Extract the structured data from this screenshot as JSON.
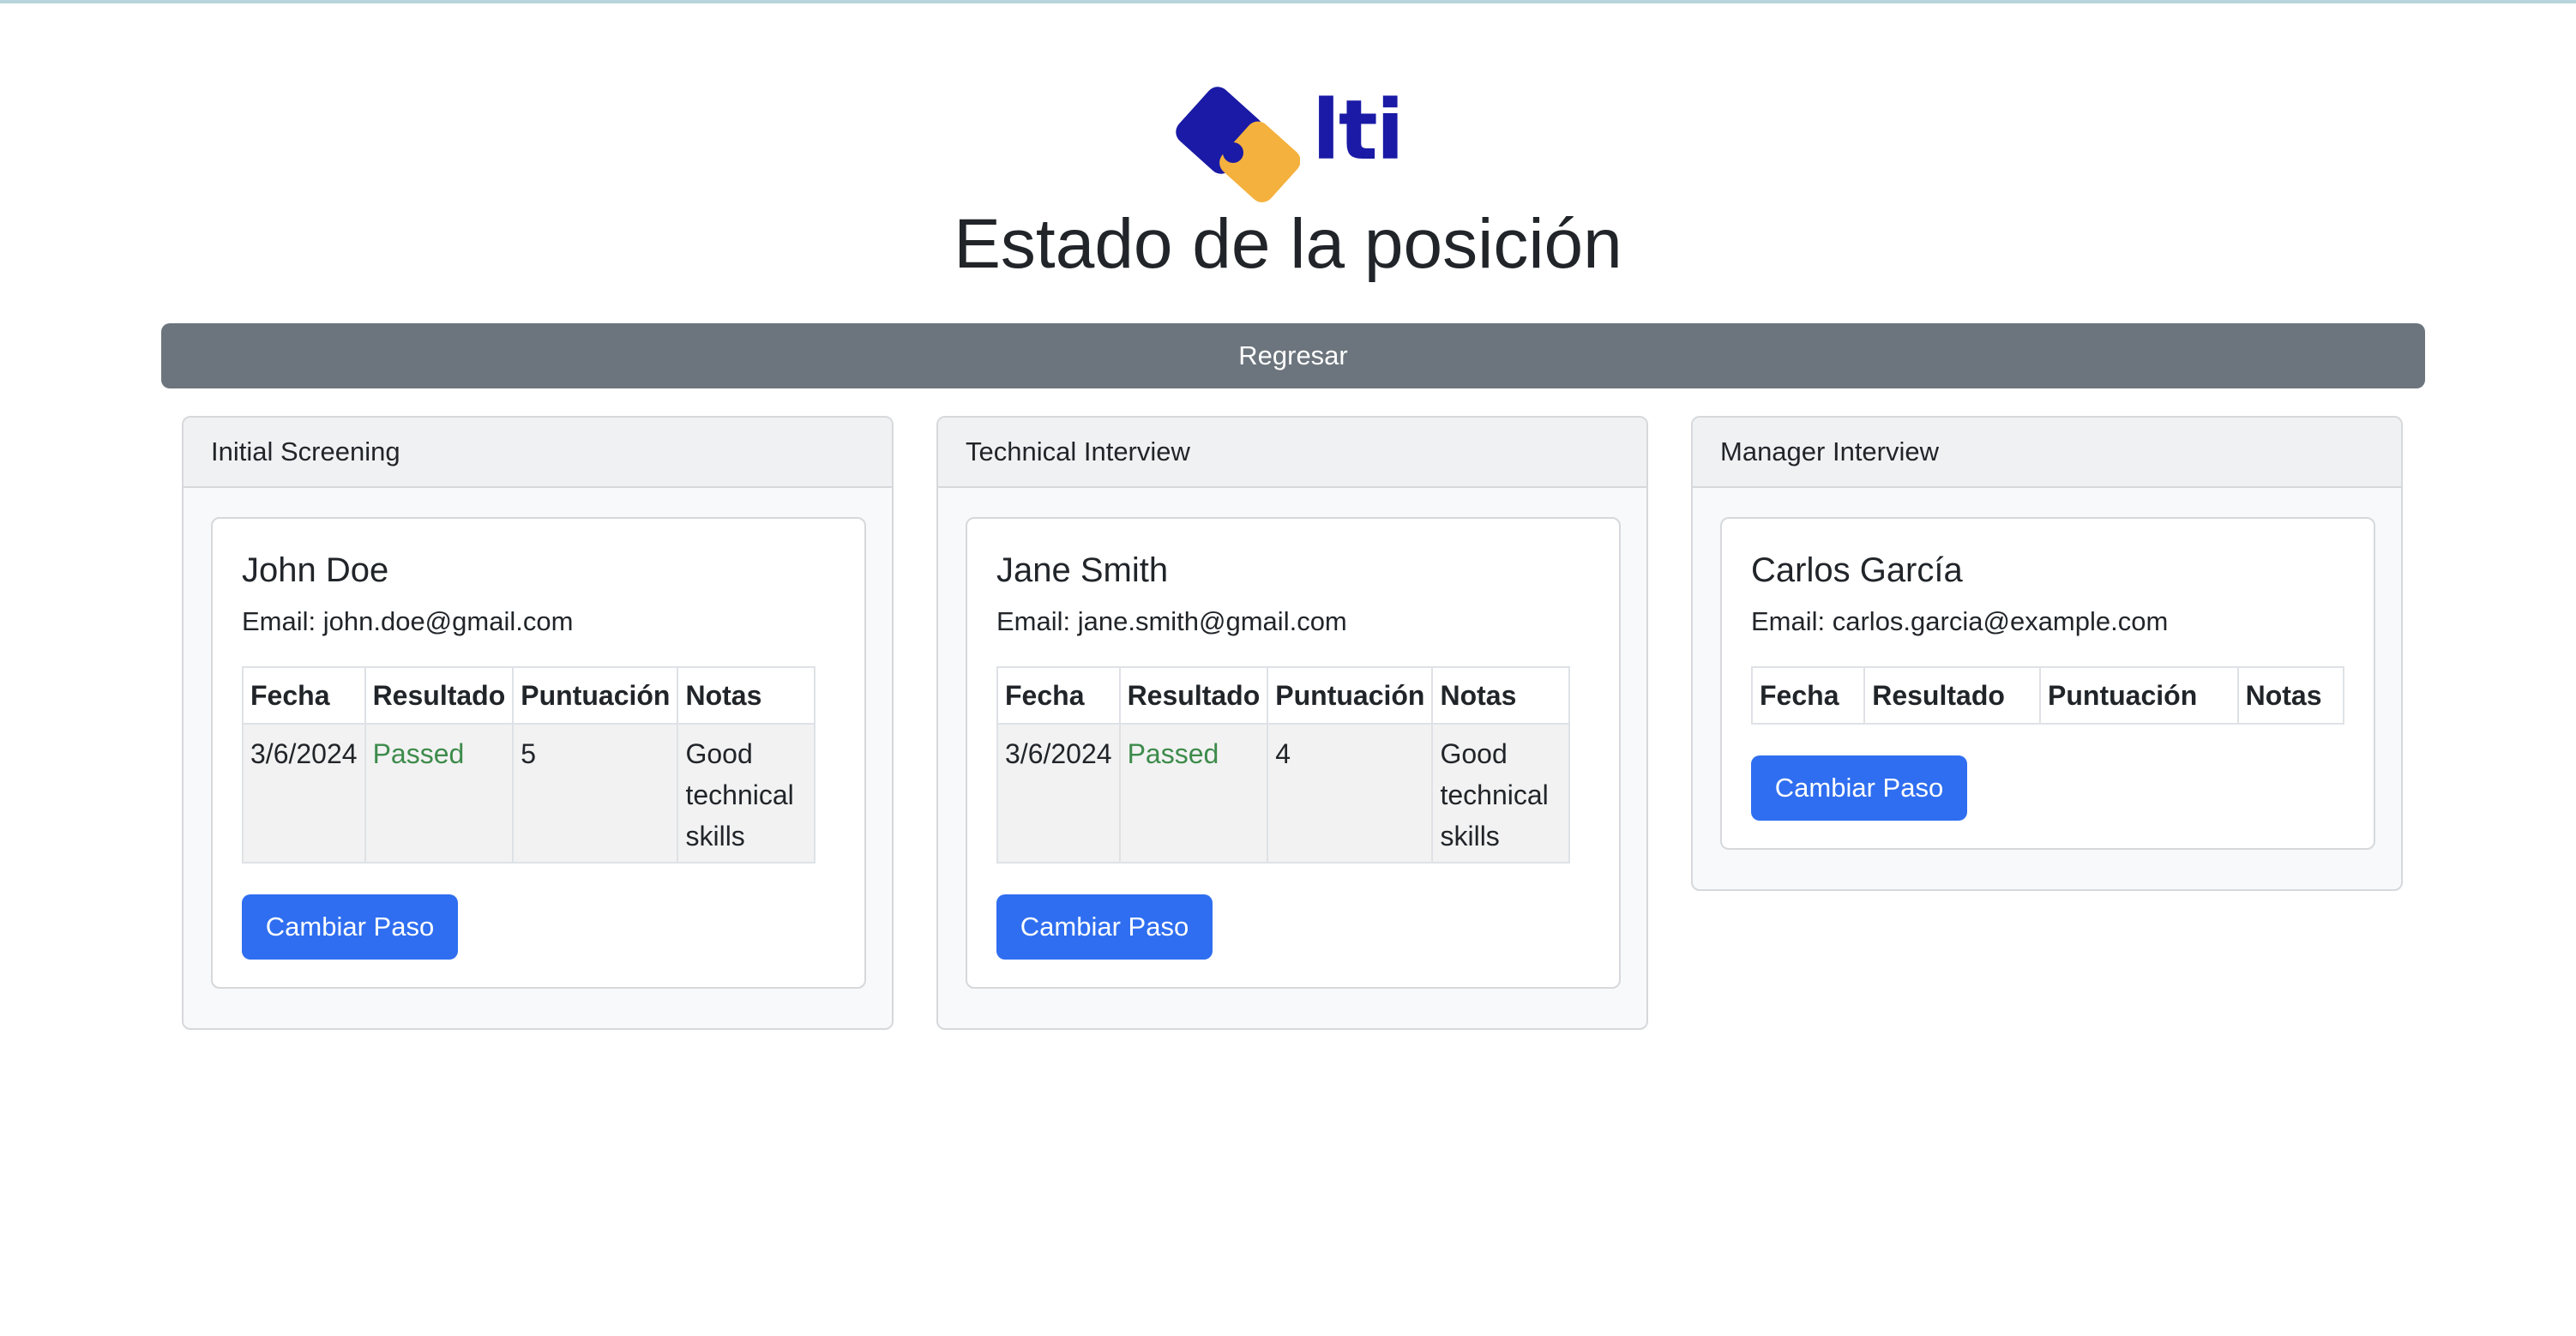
{
  "header": {
    "logo_text": "lti",
    "title": "Estado de la posición"
  },
  "back_button": {
    "label": "Regresar"
  },
  "colors": {
    "logo_blue": "#1a1aa6",
    "logo_yellow": "#f4b13d",
    "back_button": "#6c757d",
    "primary_button": "#2f6ef0",
    "passed_text": "#3d8b4b"
  },
  "table_headers": [
    "Fecha",
    "Resultado",
    "Puntuación",
    "Notas"
  ],
  "columns": [
    {
      "title": "Initial Screening",
      "candidate": {
        "name": "John Doe",
        "email": "Email: john.doe@gmail.com",
        "rows": [
          {
            "date": "3/6/2024",
            "result": "Passed",
            "score": "5",
            "notes": "Good technical skills"
          }
        ],
        "button_label": "Cambiar Paso"
      }
    },
    {
      "title": "Technical Interview",
      "candidate": {
        "name": "Jane Smith",
        "email": "Email: jane.smith@gmail.com",
        "rows": [
          {
            "date": "3/6/2024",
            "result": "Passed",
            "score": "4",
            "notes": "Good technical skills"
          }
        ],
        "button_label": "Cambiar Paso"
      }
    },
    {
      "title": "Manager Interview",
      "candidate": {
        "name": "Carlos García",
        "email": "Email: carlos.garcia@example.com",
        "rows": [],
        "button_label": "Cambiar Paso"
      }
    }
  ]
}
